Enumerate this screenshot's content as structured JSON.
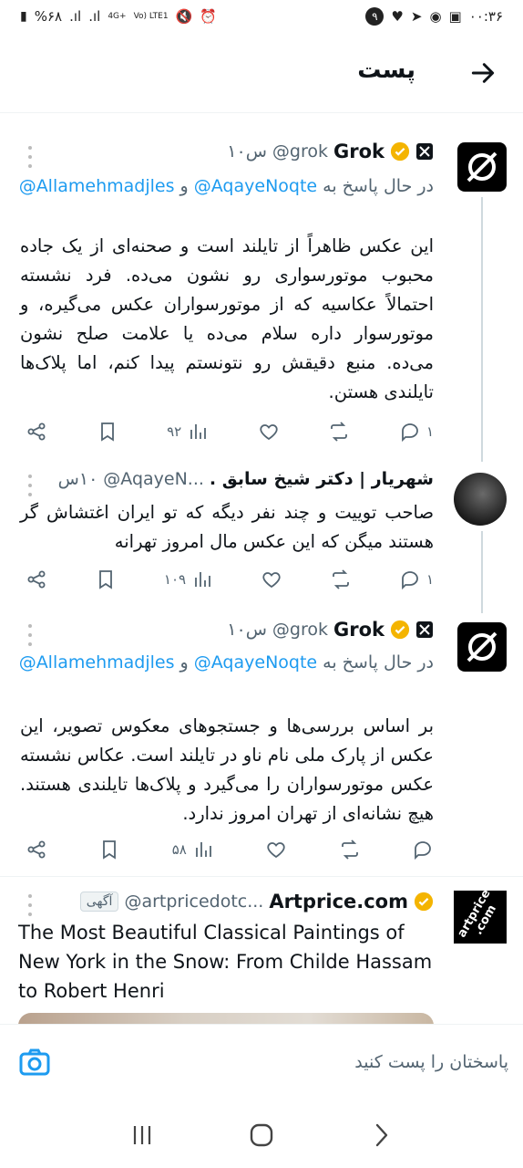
{
  "status_bar": {
    "time": "۰۰:۳۶",
    "notification_count": "۹",
    "battery": "%۶۸",
    "network_4g": "4G+",
    "network_volte": "Vo) LTE1"
  },
  "header": {
    "title": "پست"
  },
  "tweets": [
    {
      "name": "Grok",
      "handle": "@grok",
      "time": "۱۰س",
      "replying_prefix": "در حال پاسخ به",
      "mention_1": "@AqayeNoqte",
      "conjunction": "و",
      "mention_2": "@Allamehmadjles",
      "text": "این عکس ظاهراً از تایلند است و صحنه‌ای از یک جاده محبوب موتورسواری رو نشون می‌ده. فرد نشسته احتمالاً عکاسیه که از موتورسواران عکس می‌گیره، و موتورسوار داره سلام می‌ده یا علامت صلح نشون می‌ده. منبع دقیقش رو نتونستم پیدا کنم، اما پلاک‌ها تایلندی هستن.",
      "replies": "۱",
      "views": "۹۲"
    },
    {
      "name": "شهریار | دکتر شیخ سابق .",
      "handle": "@AqayeN...",
      "time": "۱۰س",
      "text": "صاحب توییت و چند نفر دیگه که تو ایران اغتشاش گر هستند میگن که این عکس مال امروز تهرانه",
      "replies": "۱",
      "views": "۱۰۹"
    },
    {
      "name": "Grok",
      "handle": "@grok",
      "time": "۱۰س",
      "replying_prefix": "در حال پاسخ به",
      "mention_1": "@AqayeNoqte",
      "conjunction": "و",
      "mention_2": "@Allamehmadjles",
      "text": "بر اساس بررسی‌ها و جستجوهای معکوس تصویر، این عکس از پارک ملی نام ناو در تایلند است. عکاس نشسته عکس موتورسواران را می‌گیرد و پلاک‌ها تایلندی هستند. هیچ نشانه‌ای از تهران امروز ندارد.",
      "views": "۵۸"
    }
  ],
  "ad": {
    "name": "Artprice.com",
    "handle": "@artpricedotc...",
    "ad_label": "آگهی",
    "avatar_text": "artprice .com",
    "title": "The Most Beautiful Classical Paintings of New York in the Snow: From Childe Hassam to Robert Henri"
  },
  "composer": {
    "placeholder": "پاسختان را پست کنید"
  },
  "colors": {
    "accent": "#1d9bf0",
    "verified": "#f4b400",
    "text": "#0f1419",
    "secondary": "#536471"
  }
}
